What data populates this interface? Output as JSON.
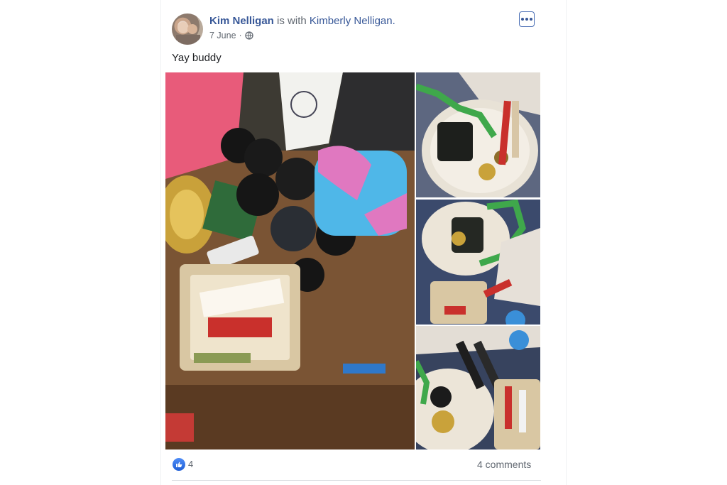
{
  "post": {
    "author": "Kim Nelligan",
    "with_text": "is with",
    "tagged": "Kimberly Nelligan.",
    "date": "7 June",
    "separator": "·",
    "privacy_icon": "globe-icon",
    "menu_icon": "more-options-icon",
    "caption": "Yay buddy"
  },
  "photos": [
    {
      "role": "main-photo"
    },
    {
      "role": "side-photo-1"
    },
    {
      "role": "side-photo-2"
    },
    {
      "role": "side-photo-3"
    }
  ],
  "footer": {
    "reaction_icon": "like-icon",
    "like_count": "4",
    "comments": "4 comments"
  },
  "colors": {
    "link": "#385898",
    "meta": "#606770",
    "like": "#1f5fd6"
  }
}
